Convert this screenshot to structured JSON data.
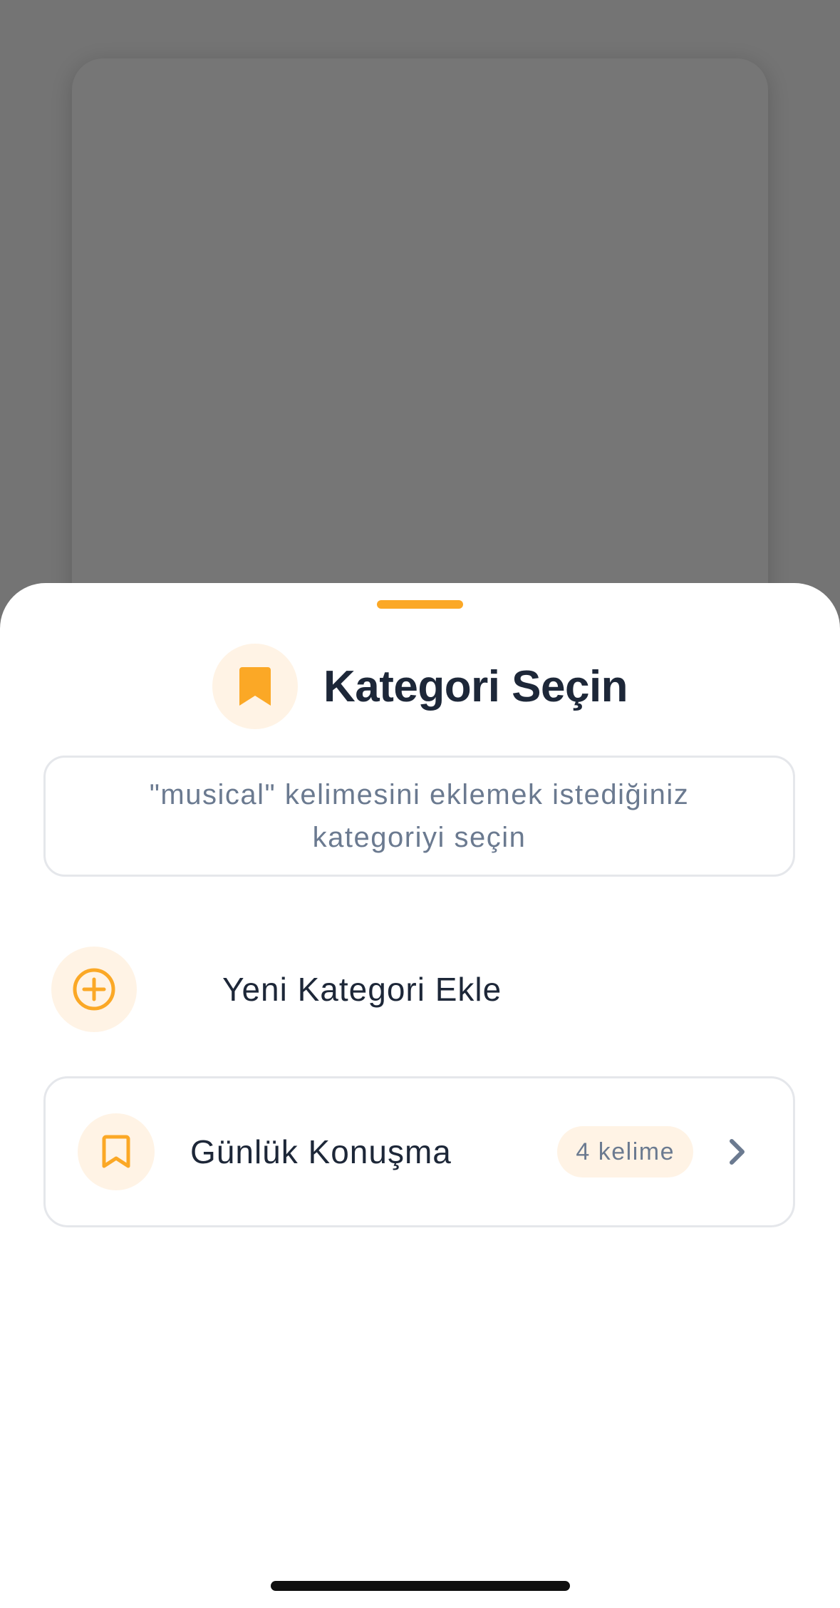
{
  "sheet": {
    "title": "Kategori Seçin",
    "title_icon": "bookmark-filled-icon",
    "instruction": "\"musical\" kelimesini eklemek istediğiniz kategoriyi seçin",
    "add_category": {
      "label": "Yeni Kategori Ekle",
      "icon": "plus-circle-icon"
    },
    "categories": [
      {
        "name": "Günlük Konuşma",
        "count_label": "4 kelime",
        "icon": "bookmark-outline-icon",
        "trailing_icon": "chevron-right-icon"
      }
    ]
  },
  "colors": {
    "accent": "#FBA826",
    "accent_soft": "#FFF3E5",
    "text_primary": "#1D2738",
    "text_secondary": "#6B7A90",
    "border": "#E5E7EB",
    "backdrop": "#747474"
  }
}
